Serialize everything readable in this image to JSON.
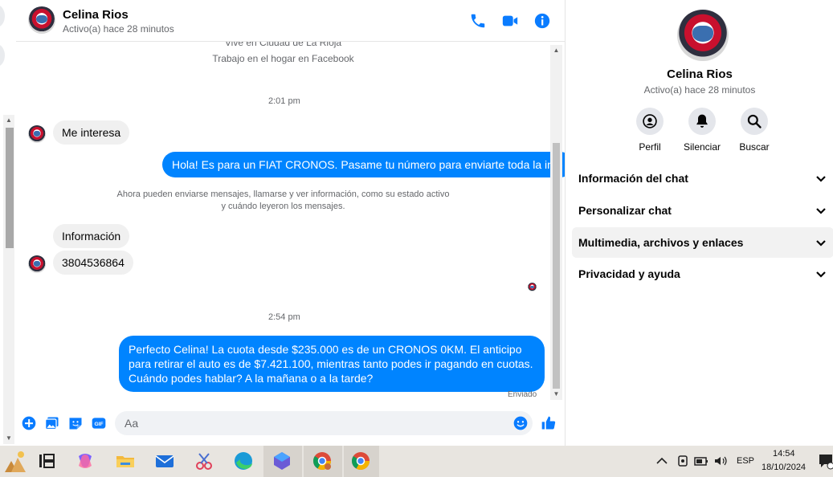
{
  "contact": {
    "name": "Celina Rios",
    "status": "Activo(a) hace 28 minutos"
  },
  "header_icons": [
    "phone-icon",
    "video-icon",
    "info-icon"
  ],
  "messages_area": {
    "intro_line1": "Vive en Ciudad de La Rioja",
    "intro_line2": "Trabajo en el hogar en Facebook",
    "time1": "2:01 pm",
    "msg1": "Me interesa",
    "msg2": "Hola! Es para un FIAT CRONOS. Pasame tu número para enviarte toda la info",
    "notice_line1": "Ahora pueden enviarse mensajes, llamarse y ver información, como su estado activo",
    "notice_line2": "y cuándo leyeron los mensajes.",
    "msg3": "Información",
    "msg4": "3804536864",
    "time2": "2:54 pm",
    "msg5": "Perfecto Celina!  La cuota desde $235.000 es de un CRONOS 0KM. El anticipo para retirar el auto es de $7.421.100, mientras tanto podes ir pagando en cuotas. Cuándo podes hablar? A la mañana o a la tarde?",
    "sent_label": "Enviado"
  },
  "composer": {
    "placeholder": "Aa",
    "icons": [
      "plus-icon",
      "photo-icon",
      "sticker-icon",
      "gif-icon",
      "emoji-icon",
      "like-icon"
    ],
    "gif_label": "GIF"
  },
  "side_panel": {
    "name": "Celina Rios",
    "status": "Activo(a) hace 28 minutos",
    "actions": [
      {
        "label": "Perfil",
        "icon": "profile-icon"
      },
      {
        "label": "Silenciar",
        "icon": "bell-icon"
      },
      {
        "label": "Buscar",
        "icon": "search-icon"
      }
    ],
    "sections": [
      {
        "label": "Información del chat"
      },
      {
        "label": "Personalizar chat"
      },
      {
        "label": "Multimedia, archivos y enlaces",
        "selected": true
      },
      {
        "label": "Privacidad y ayuda"
      }
    ]
  },
  "taskbar": {
    "language": "ESP",
    "time": "14:54",
    "date": "18/10/2024"
  },
  "colors": {
    "accent": "#0084ff",
    "icon_blue": "#0a7cff",
    "bubble_in": "#f0f0f0"
  }
}
